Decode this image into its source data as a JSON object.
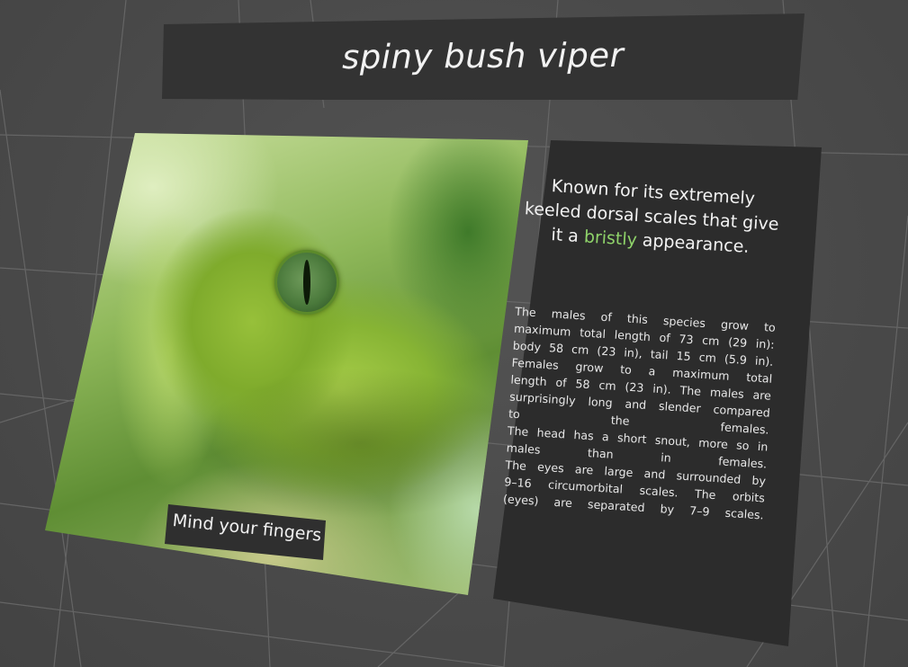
{
  "title": "spiny bush viper",
  "photo": {
    "caption": "Mind your fingers"
  },
  "info": {
    "highlight": {
      "before": "Known for its extremely keeled dorsal scales that give it a",
      "accent": "bristly",
      "after": "appearance.",
      "accent_color": "#8fd36a"
    },
    "body_lines": [
      "The males of this species grow to",
      "maximum total length of 73 cm (29 in):",
      "body 58 cm (23 in), tail 15 cm (5.9 in).",
      "Females grow to a maximum total",
      "length of 58 cm (23 in). The males are",
      "surprisingly long and slender compared",
      "to the females.",
      "The head has a short snout, more so in",
      "males than in females.",
      "The eyes are large and surrounded by",
      "9–16 circumorbital scales. The orbits",
      "(eyes) are separated by 7–9 scales."
    ]
  },
  "colors": {
    "background": "#4a4a4a",
    "panel": "#2c2c2c",
    "title_panel": "#333333",
    "grid_line": "#6a6a6a",
    "accent": "#8fd36a"
  }
}
